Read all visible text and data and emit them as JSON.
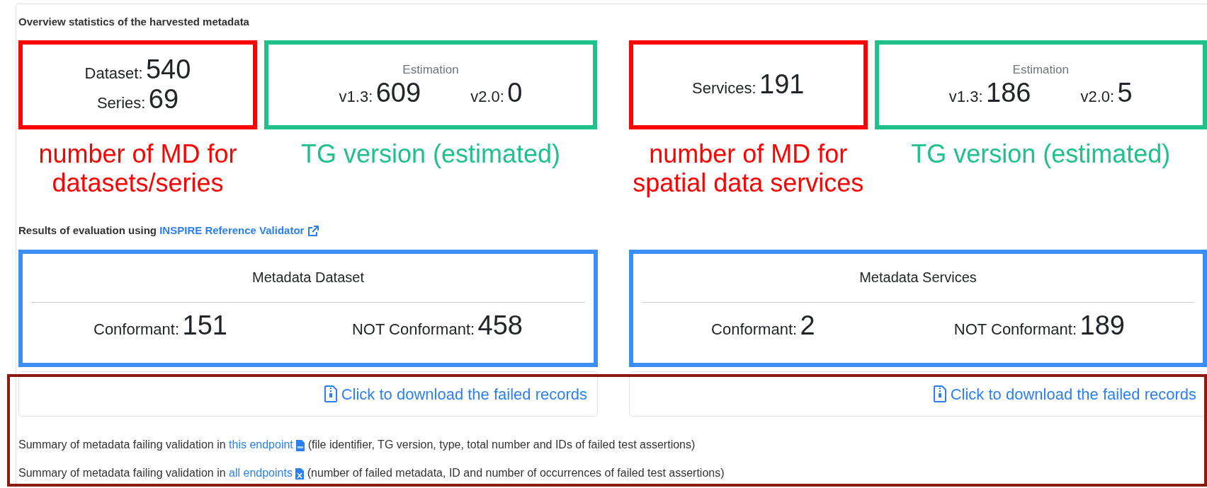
{
  "title": "Overview statistics of the harvested metadata",
  "overview": [
    {
      "counts": [
        {
          "label": "Dataset:",
          "value": "540"
        },
        {
          "label": "Series:",
          "value": "69"
        }
      ],
      "estimation": {
        "heading": "Estimation",
        "items": [
          {
            "label": "v1.3:",
            "value": "609"
          },
          {
            "label": "v2.0:",
            "value": "0"
          }
        ]
      },
      "annotations": [
        {
          "text": "number of MD for datasets/series",
          "color": "#ff0000"
        },
        {
          "text": "TG version (estimated)",
          "color": "#20c08a"
        }
      ]
    },
    {
      "counts": [
        {
          "label": "Services:",
          "value": "191"
        }
      ],
      "estimation": {
        "heading": "Estimation",
        "items": [
          {
            "label": "v1.3:",
            "value": "186"
          },
          {
            "label": "v2.0:",
            "value": "5"
          }
        ]
      },
      "annotations": [
        {
          "text": "number of MD for spatial data services",
          "color": "#ff0000"
        },
        {
          "text": "TG version (estimated)",
          "color": "#20c08a"
        }
      ]
    }
  ],
  "evaluation": {
    "prefix": "Results of evaluation using",
    "link": "INSPIRE Reference Validator"
  },
  "validation": [
    {
      "title": "Metadata Dataset",
      "conformant_label": "Conformant:",
      "conformant": "151",
      "not_label": "NOT Conformant:",
      "not_conformant": "458",
      "download": "Click to download the failed records"
    },
    {
      "title": "Metadata Services",
      "conformant_label": "Conformant:",
      "conformant": "2",
      "not_label": "NOT Conformant:",
      "not_conformant": "189",
      "download": "Click to download the failed records"
    }
  ],
  "summary": [
    {
      "prefix": "Summary of metadata failing validation in",
      "link": "this endpoint",
      "kind": "csv",
      "suffix": "(file identifier, TG version, type, total number and IDs of failed test assertions)"
    },
    {
      "prefix": "Summary of metadata failing validation in",
      "link": "all endpoints",
      "kind": "excel",
      "suffix": "(number of failed metadata, ID and number of occurrences of failed test assertions)"
    }
  ]
}
